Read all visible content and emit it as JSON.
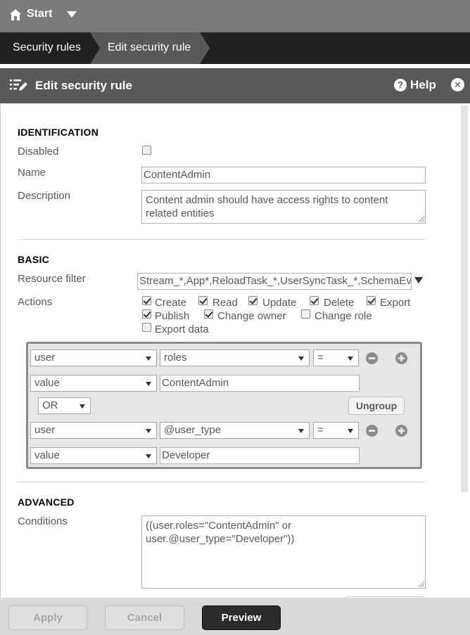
{
  "topbar": {
    "start_label": "Start"
  },
  "breadcrumb": {
    "items": [
      "Security rules",
      "Edit security rule"
    ]
  },
  "dialog": {
    "title": "Edit security rule",
    "help_label": "Help"
  },
  "identification": {
    "section_title": "IDENTIFICATION",
    "disabled_label": "Disabled",
    "disabled_checked": false,
    "name_label": "Name",
    "name_value": "ContentAdmin",
    "description_label": "Description",
    "description_value": "Content admin should have access rights to content related entities"
  },
  "basic": {
    "section_title": "BASIC",
    "resource_filter_label": "Resource filter",
    "resource_filter_value": "Stream_*,App*,ReloadTask_*,UserSyncTask_*,SchemaEvent_*",
    "actions_label": "Actions",
    "actions": [
      {
        "label": "Create",
        "checked": true
      },
      {
        "label": "Read",
        "checked": true
      },
      {
        "label": "Update",
        "checked": true
      },
      {
        "label": "Delete",
        "checked": true
      },
      {
        "label": "Export",
        "checked": true
      },
      {
        "label": "Publish",
        "checked": true
      },
      {
        "label": "Change owner",
        "checked": true
      },
      {
        "label": "Change role",
        "checked": false
      },
      {
        "label": "Export data",
        "checked": false
      }
    ]
  },
  "builder": {
    "group1": {
      "subject": "user",
      "property": "roles",
      "operator": "=",
      "value_type": "value",
      "value": "ContentAdmin"
    },
    "logic": "OR",
    "ungroup_label": "Ungroup",
    "group2": {
      "subject": "user",
      "property": "@user_type",
      "operator": "=",
      "value_type": "value",
      "value": "Developer"
    }
  },
  "advanced": {
    "section_title": "ADVANCED",
    "conditions_label": "Conditions",
    "conditions_value": "((user.roles=\"ContentAdmin\" or user.@user_type=\"Developer\"))"
  },
  "footer": {
    "apply_label": "Apply",
    "cancel_label": "Cancel",
    "preview_label": "Preview"
  }
}
